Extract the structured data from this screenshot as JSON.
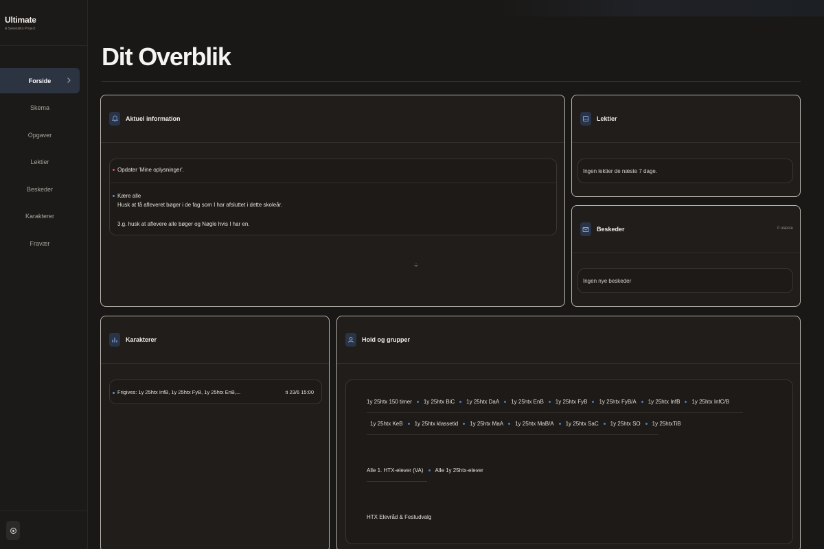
{
  "app": {
    "title": "Ultimate",
    "subtitle": "A Sweetalko Project"
  },
  "nav": {
    "items": [
      {
        "label": "Forside",
        "active": true
      },
      {
        "label": "Skema"
      },
      {
        "label": "Opgaver"
      },
      {
        "label": "Lektier"
      },
      {
        "label": "Beskeder"
      },
      {
        "label": "Karakterer"
      },
      {
        "label": "Fravær"
      }
    ]
  },
  "page": {
    "title": "Dit Overblik"
  },
  "cards": {
    "info": {
      "title": "Aktuel information",
      "icon": "bell-icon",
      "items": [
        {
          "text": "Opdater 'Mine oplysninger'."
        },
        {
          "greeting": "Kære alle",
          "line1": "Husk at få afleveret bøger i de fag som  I har afsluttet i dette skoleår.",
          "line2": "3.g. husk at aflevere alle bøger og Nøgle hvis I har en."
        }
      ],
      "expand_symbol": "÷"
    },
    "lektier": {
      "title": "Lektier",
      "icon": "book-icon",
      "empty": "Ingen lektier de næste 7 dage."
    },
    "beskeder": {
      "title": "Beskeder",
      "icon": "mail-icon",
      "meta": "0 ulæste",
      "empty": "Ingen nye beskeder"
    },
    "karakterer": {
      "title": "Karakterer",
      "icon": "chart-icon",
      "row_text": "Frigives: 1y 25htx InfB, 1y 25htx FyB, 1y 25htx EnB,...",
      "row_date": "ti 23/6 15:00"
    },
    "hold": {
      "title": "Hold og grupper",
      "icon": "group-icon",
      "row1": [
        "1y 25htx 150 timer",
        "1y 25htx BiC",
        "1y 25htx DaA",
        "1y 25htx EnB",
        "1y 25htx FyB",
        "1y 25htx FyB/A",
        "1y 25htx InfB",
        "1y 25htx InfC/B"
      ],
      "row2": [
        "1y 25htx KeB",
        "1y 25htx klassetid",
        "1y 25htx MaA",
        "1y 25htx MaB/A",
        "1y 25htx SaC",
        "1y 25htx SO",
        "1y 25htxTiB"
      ],
      "row3": [
        "Alle 1. HTX-elever (VA)",
        "Alle 1y 25htx-elever"
      ],
      "row4": [
        "HTX Elevråd & Festudvalg"
      ]
    }
  },
  "colors": {
    "accent": "#2c3442",
    "background": "#1a1816",
    "card": "#201d1a"
  }
}
